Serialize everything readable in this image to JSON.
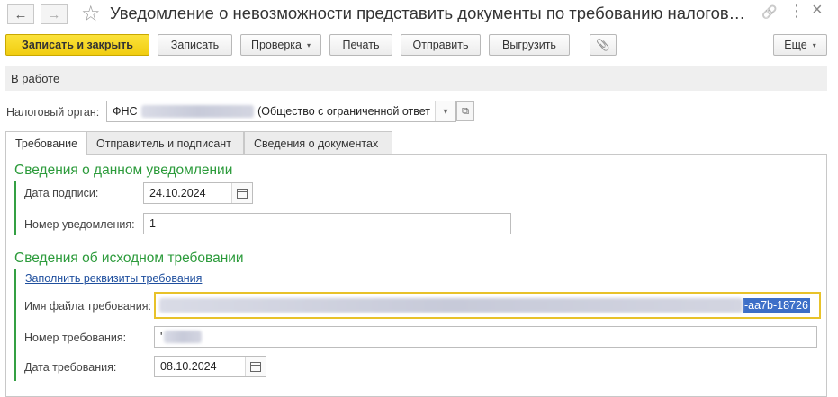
{
  "window": {
    "title": "Уведомление о невозможности представить документы по требованию налогового органа",
    "back_glyph": "←",
    "forward_glyph": "→",
    "star_glyph": "☆",
    "link_glyph": "🔗",
    "more_glyph": "⋮",
    "close_glyph": "×"
  },
  "toolbar": {
    "save_close": "Записать и закрыть",
    "save": "Записать",
    "check": "Проверка",
    "print": "Печать",
    "send": "Отправить",
    "export": "Выгрузить",
    "attach_glyph": "📎",
    "more": "Еще",
    "caret": "▾"
  },
  "status": {
    "label": "В работе"
  },
  "tax_authority": {
    "label": "Налоговый орган:",
    "value_prefix": "ФНС",
    "value_suffix": "(Общество с ограниченной ответ",
    "dropdown_glyph": "▾",
    "open_glyph": "⧉"
  },
  "tabs": [
    {
      "label": "Требование"
    },
    {
      "label": "Отправитель и подписант"
    },
    {
      "label": "Сведения о документах"
    }
  ],
  "section_notification": {
    "title": "Сведения о данном уведомлении",
    "sign_date_label": "Дата подписи:",
    "sign_date_value": "24.10.2024",
    "number_label": "Номер уведомления:",
    "number_value": "1"
  },
  "section_request": {
    "title": "Сведения об исходном требовании",
    "fill_link": "Заполнить реквизиты требования",
    "file_name_label": "Имя файла требования:",
    "file_name_visible_tail": "-aa7b-18726",
    "request_number_label": "Номер требования:",
    "request_number_value": "'",
    "request_date_label": "Дата требования:",
    "request_date_value": "08.10.2024"
  },
  "colors": {
    "primary_button": "#f5d522",
    "section_green": "#2c9b3b",
    "link_blue": "#1f4f9e",
    "focus_border": "#e8c22a",
    "selection": "#3d6fc8"
  }
}
